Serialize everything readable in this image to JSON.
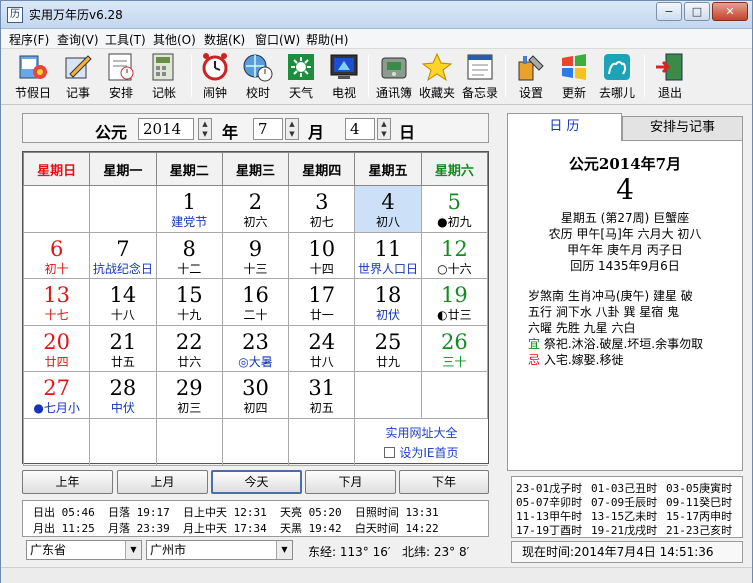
{
  "window": {
    "title": "实用万年历v6.28",
    "app_icon": "calendar-icon",
    "buttons": {
      "minimize": "−",
      "maximize": "□",
      "close": "✕"
    }
  },
  "menu": [
    "程序(F)",
    "查询(V)",
    "工具(T)",
    "其他(O)",
    "数据(K)",
    "窗口(W)",
    "帮助(H)"
  ],
  "toolbar": [
    {
      "label": "节假日",
      "icon": "holiday-icon"
    },
    {
      "label": "记事",
      "icon": "notes-icon"
    },
    {
      "label": "安排",
      "icon": "schedule-icon"
    },
    {
      "label": "记帐",
      "icon": "ledger-icon"
    },
    {
      "label": "闹钟",
      "icon": "alarm-clock-icon"
    },
    {
      "label": "校时",
      "icon": "time-sync-icon"
    },
    {
      "label": "天气",
      "icon": "weather-icon"
    },
    {
      "label": "电视",
      "icon": "tv-icon"
    },
    {
      "label": "通讯簿",
      "icon": "address-book-icon"
    },
    {
      "label": "收藏夹",
      "icon": "favorites-star-icon"
    },
    {
      "label": "备忘录",
      "icon": "memo-icon"
    },
    {
      "label": "设置",
      "icon": "settings-tools-icon"
    },
    {
      "label": "更新",
      "icon": "update-icon"
    },
    {
      "label": "去哪儿",
      "icon": "qunar-camel-icon"
    },
    {
      "label": "退出",
      "icon": "exit-door-icon"
    }
  ],
  "date_selector": {
    "era": "公元",
    "year": "2014",
    "year_unit": "年",
    "month": "7",
    "month_unit": "月",
    "day": "4",
    "day_unit": "日"
  },
  "calendar": {
    "weekdays": [
      "星期日",
      "星期一",
      "星期二",
      "星期三",
      "星期四",
      "星期五",
      "星期六"
    ],
    "weeks": [
      [
        null,
        null,
        {
          "d": "1",
          "s": "建党节",
          "sc": "blue"
        },
        {
          "d": "2",
          "s": "初六"
        },
        {
          "d": "3",
          "s": "初七"
        },
        {
          "d": "4",
          "s": "初八",
          "today": true
        },
        {
          "d": "5",
          "s": "●初九",
          "dc": "green"
        }
      ],
      [
        {
          "d": "6",
          "s": "初十",
          "dc": "red",
          "sc": "red"
        },
        {
          "d": "7",
          "s": "抗战纪念日",
          "sc": "blue"
        },
        {
          "d": "8",
          "s": "十二"
        },
        {
          "d": "9",
          "s": "十三"
        },
        {
          "d": "10",
          "s": "十四"
        },
        {
          "d": "11",
          "s": "世界人口日",
          "sc": "blue"
        },
        {
          "d": "12",
          "s": "○十六",
          "dc": "green"
        }
      ],
      [
        {
          "d": "13",
          "s": "十七",
          "dc": "red",
          "sc": "red"
        },
        {
          "d": "14",
          "s": "十八"
        },
        {
          "d": "15",
          "s": "十九"
        },
        {
          "d": "16",
          "s": "二十"
        },
        {
          "d": "17",
          "s": "廿一"
        },
        {
          "d": "18",
          "s": "初伏",
          "sc": "blue"
        },
        {
          "d": "19",
          "s": "◐廿三",
          "dc": "green"
        }
      ],
      [
        {
          "d": "20",
          "s": "廿四",
          "dc": "red",
          "sc": "red"
        },
        {
          "d": "21",
          "s": "廿五"
        },
        {
          "d": "22",
          "s": "廿六"
        },
        {
          "d": "23",
          "s": "◎大暑",
          "sc": "blue"
        },
        {
          "d": "24",
          "s": "廿八"
        },
        {
          "d": "25",
          "s": "廿九"
        },
        {
          "d": "26",
          "s": "三十",
          "dc": "green",
          "sc": "green"
        }
      ],
      [
        {
          "d": "27",
          "s": "●七月小",
          "dc": "red",
          "sc": "blue"
        },
        {
          "d": "28",
          "s": "中伏",
          "sc": "blue"
        },
        {
          "d": "29",
          "s": "初三"
        },
        {
          "d": "30",
          "s": "初四"
        },
        {
          "d": "31",
          "s": "初五"
        },
        null,
        null
      ]
    ],
    "link_sites": "实用网址大全",
    "link_homepage": "设为IE首页"
  },
  "nav_buttons": [
    "上年",
    "上月",
    "今天",
    "下月",
    "下年"
  ],
  "sun_moon": {
    "row1": "日出 05:46  日落 19:17  日上中天 12:31  天亮 05:20  日照时间 13:31",
    "row2": "月出 11:25  月落 23:39  月上中天 17:34  天黑 19:42  白天时间 14:22"
  },
  "location": {
    "province": "广东省",
    "city": "广州市",
    "longitude": "东经: 113° 16′",
    "latitude": "北纬: 23° 8′"
  },
  "tabs": [
    "日    历",
    "安排与记事"
  ],
  "day_detail": {
    "header": "公元2014年7月",
    "day": "4",
    "line1": "星期五 (第27周) 巨蟹座",
    "line2": "农历 甲午[马]年 六月大 初八",
    "line3": "甲午年 庚午月 丙子日",
    "line4": "回历 1435年9月6日",
    "almanac1": "岁煞南 生肖冲马(庚午) 建星 破",
    "almanac2": "五行 涧下水 八卦 巽 星宿 鬼",
    "almanac3": "六曜 先胜 九星 六白",
    "yi_label": "宜",
    "yi": "祭祀.沐浴.破屋.坏垣.余事勿取",
    "ji_label": "忌",
    "ji": "入宅.嫁娶.移徙"
  },
  "hours": [
    "23-01戊子时",
    "01-03己丑时",
    "03-05庚寅时",
    "05-07辛卯时",
    "07-09壬辰时",
    "09-11癸巳时",
    "11-13甲午时",
    "13-15乙未时",
    "15-17丙申时",
    "17-19丁酉时",
    "19-21戊戌时",
    "21-23己亥时"
  ],
  "now": "现在时间:2014年7月4日  14:51:36",
  "colors": {
    "sunday": "#e01414",
    "saturday": "#128a20",
    "festival": "#1535b8",
    "today_bg": "#cce0f8"
  }
}
